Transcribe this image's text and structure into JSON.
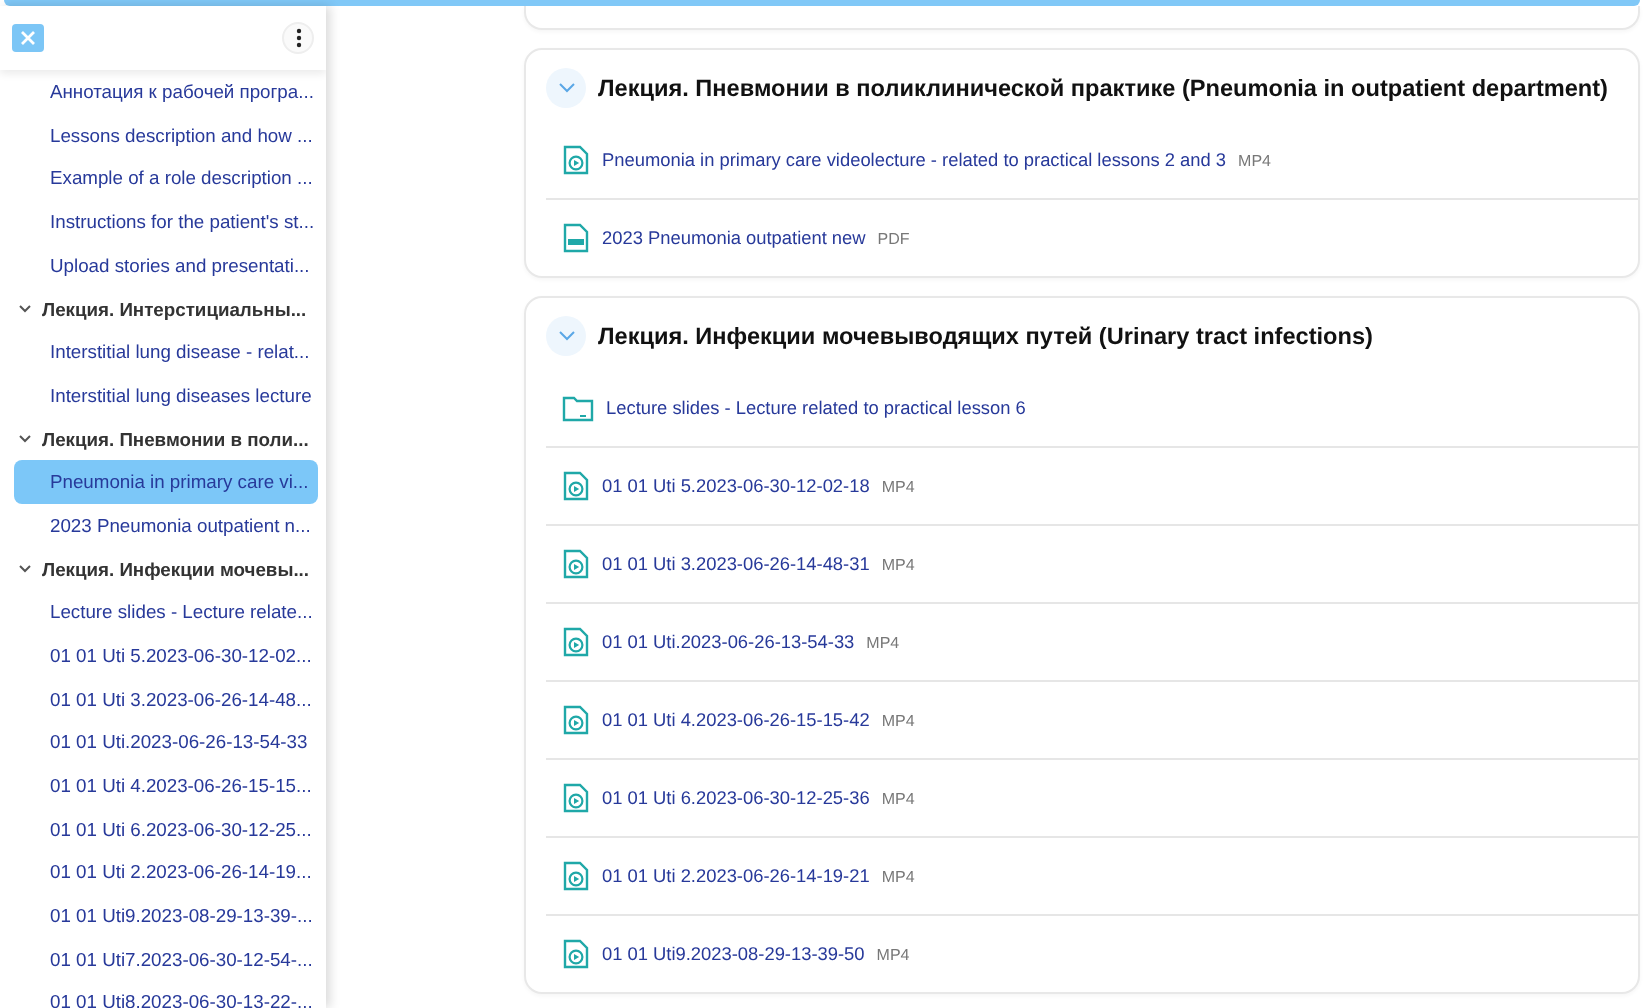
{
  "sidebar": {
    "items": [
      {
        "kind": "link",
        "label": "Аннотация к рабочей програ...",
        "selected": false
      },
      {
        "kind": "link",
        "label": "Lessons description and how ...",
        "selected": false
      },
      {
        "kind": "link",
        "label": "Example of a role description ...",
        "selected": false
      },
      {
        "kind": "link",
        "label": "Instructions for the patient's st...",
        "selected": false
      },
      {
        "kind": "link",
        "label": "Upload stories and presentati...",
        "selected": false
      },
      {
        "kind": "section",
        "label": "Лекция. Интерстициальны...",
        "expanded": true,
        "children": [
          {
            "kind": "link",
            "label": "Interstitial lung disease - relat...",
            "selected": false
          },
          {
            "kind": "link",
            "label": "Interstitial lung diseases lecture",
            "selected": false
          }
        ]
      },
      {
        "kind": "section",
        "label": "Лекция. Пневмонии в поли...",
        "expanded": true,
        "children": [
          {
            "kind": "link",
            "label": "Pneumonia in primary care vi...",
            "selected": true
          },
          {
            "kind": "link",
            "label": "2023 Pneumonia outpatient n...",
            "selected": false
          }
        ]
      },
      {
        "kind": "section",
        "label": "Лекция. Инфекции мочевы...",
        "expanded": true,
        "children": [
          {
            "kind": "link",
            "label": "Lecture slides - Lecture relate...",
            "selected": false
          },
          {
            "kind": "link",
            "label": "01 01 Uti 5.2023-06-30-12-02...",
            "selected": false
          },
          {
            "kind": "link",
            "label": "01 01 Uti 3.2023-06-26-14-48...",
            "selected": false
          },
          {
            "kind": "link",
            "label": "01 01 Uti.2023-06-26-13-54-33",
            "selected": false
          },
          {
            "kind": "link",
            "label": "01 01 Uti 4.2023-06-26-15-15...",
            "selected": false
          },
          {
            "kind": "link",
            "label": "01 01 Uti 6.2023-06-30-12-25...",
            "selected": false
          },
          {
            "kind": "link",
            "label": "01 01 Uti 2.2023-06-26-14-19...",
            "selected": false
          },
          {
            "kind": "link",
            "label": "01 01 Uti9.2023-08-29-13-39-...",
            "selected": false
          },
          {
            "kind": "link",
            "label": "01 01 Uti7.2023-06-30-12-54-...",
            "selected": false
          },
          {
            "kind": "link",
            "label": "01 01 Uti8.2023-06-30-13-22-...",
            "selected": false
          }
        ]
      }
    ]
  },
  "sections": [
    {
      "title": "Лекция. Пневмонии в поликлинической практике (Pneumonia in outpatient department)",
      "expanded": true,
      "items": [
        {
          "kind": "video",
          "title": "Pneumonia in primary care videolecture - related to practical lessons 2 and 3",
          "format": "MP4"
        },
        {
          "kind": "pdf",
          "title": "2023 Pneumonia outpatient new",
          "format": "PDF"
        }
      ]
    },
    {
      "title": "Лекция. Инфекции мочевыводящих путей (Urinary tract infections)",
      "expanded": true,
      "items": [
        {
          "kind": "folder",
          "title": "Lecture slides - Lecture related to practical lesson 6"
        },
        {
          "kind": "video",
          "title": "01 01 Uti 5.2023-06-30-12-02-18",
          "format": "MP4"
        },
        {
          "kind": "video",
          "title": "01 01 Uti 3.2023-06-26-14-48-31",
          "format": "MP4"
        },
        {
          "kind": "video",
          "title": "01 01 Uti.2023-06-26-13-54-33",
          "format": "MP4"
        },
        {
          "kind": "video",
          "title": "01 01 Uti 4.2023-06-26-15-15-42",
          "format": "MP4"
        },
        {
          "kind": "video",
          "title": "01 01 Uti 6.2023-06-30-12-25-36",
          "format": "MP4"
        },
        {
          "kind": "video",
          "title": "01 01 Uti 2.2023-06-26-14-19-21",
          "format": "MP4"
        },
        {
          "kind": "video",
          "title": "01 01 Uti9.2023-08-29-13-39-50",
          "format": "MP4"
        }
      ]
    }
  ]
}
